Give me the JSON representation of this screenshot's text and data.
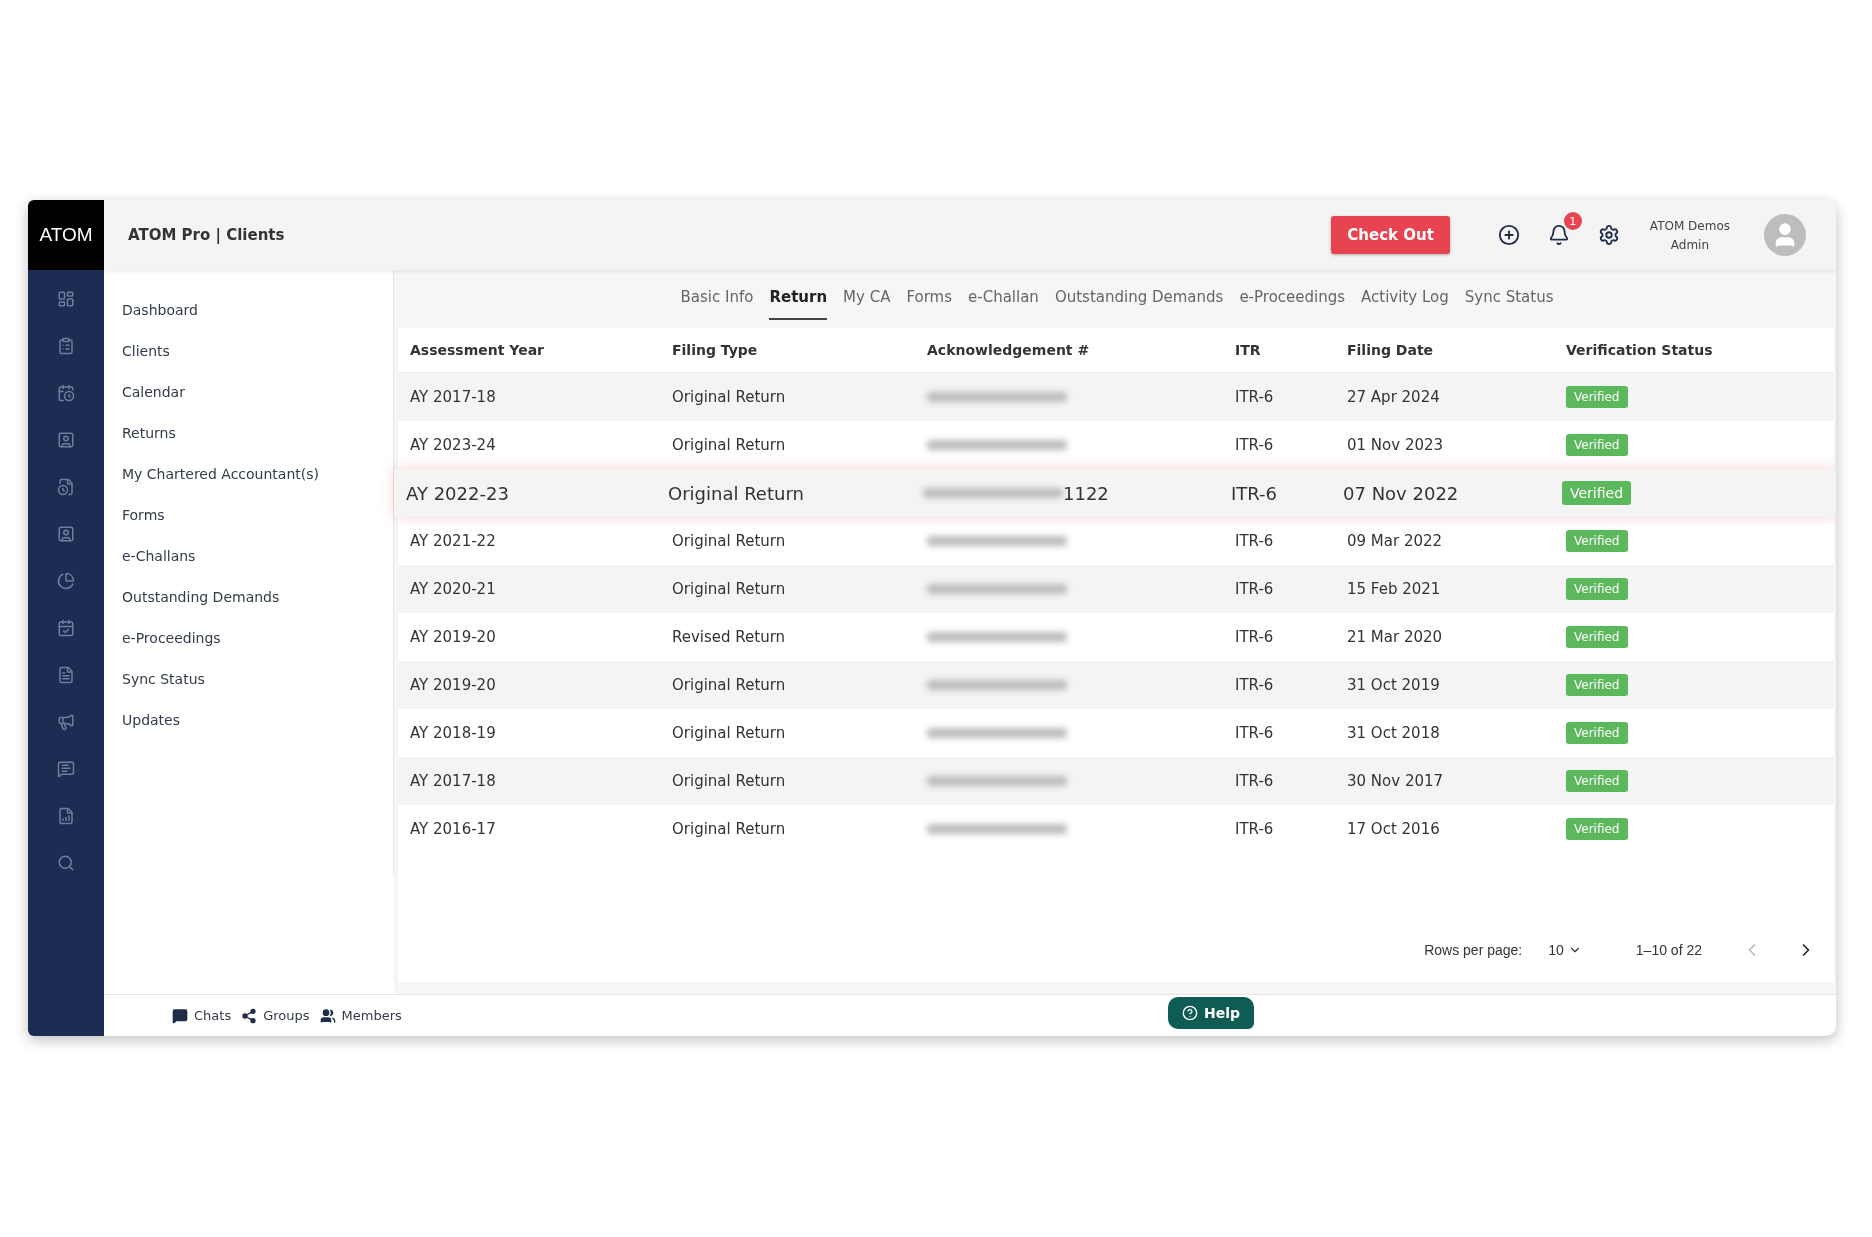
{
  "app": {
    "logo": "ATOM",
    "title": "ATOM Pro | Clients"
  },
  "header": {
    "checkout_label": "Check Out",
    "notification_count": "1",
    "user_name": "ATOM Demos",
    "user_role": "Admin"
  },
  "nav": [
    {
      "label": "Dashboard"
    },
    {
      "label": "Clients"
    },
    {
      "label": "Calendar"
    },
    {
      "label": "Returns"
    },
    {
      "label": "My Chartered Accountant(s)"
    },
    {
      "label": "Forms"
    },
    {
      "label": "e-Challans"
    },
    {
      "label": "Outstanding Demands"
    },
    {
      "label": "e-Proceedings"
    },
    {
      "label": "Sync Status"
    },
    {
      "label": "Updates"
    }
  ],
  "tabs": [
    {
      "label": "Basic Info",
      "selected": false
    },
    {
      "label": "Return",
      "selected": true
    },
    {
      "label": "My CA",
      "selected": false
    },
    {
      "label": "Forms",
      "selected": false
    },
    {
      "label": "e-Challan",
      "selected": false
    },
    {
      "label": "Outstanding Demands",
      "selected": false
    },
    {
      "label": "e-Proceedings",
      "selected": false
    },
    {
      "label": "Activity Log",
      "selected": false
    },
    {
      "label": "Sync Status",
      "selected": false
    }
  ],
  "table": {
    "columns": [
      "Assessment Year",
      "Filing Type",
      "Acknowledgement #",
      "ITR",
      "Filing Date",
      "Verification Status"
    ],
    "rows": [
      {
        "year": "AY 2017-18",
        "type": "Original Return",
        "redacted": true,
        "itr": "ITR-6",
        "date": "27 Apr 2024",
        "status": "Verified",
        "emphasized": false
      },
      {
        "year": "AY 2023-24",
        "type": "Original Return",
        "redacted": true,
        "itr": "ITR-6",
        "date": "01 Nov 2023",
        "status": "Verified",
        "emphasized": false
      },
      {
        "year": "AY 2022-23",
        "type": "Original Return",
        "redacted": true,
        "ack": "1122",
        "itr": "ITR-6",
        "date": "07 Nov 2022",
        "status": "Verified",
        "emphasized": true
      },
      {
        "year": "AY 2021-22",
        "type": "Original Return",
        "redacted": true,
        "itr": "ITR-6",
        "date": "09 Mar 2022",
        "status": "Verified",
        "emphasized": false
      },
      {
        "year": "AY 2020-21",
        "type": "Original Return",
        "redacted": true,
        "itr": "ITR-6",
        "date": "15 Feb 2021",
        "status": "Verified",
        "emphasized": false
      },
      {
        "year": "AY 2019-20",
        "type": "Revised Return",
        "redacted": true,
        "itr": "ITR-6",
        "date": "21 Mar 2020",
        "status": "Verified",
        "emphasized": false
      },
      {
        "year": "AY 2019-20",
        "type": "Original Return",
        "redacted": true,
        "itr": "ITR-6",
        "date": "31 Oct 2019",
        "status": "Verified",
        "emphasized": false
      },
      {
        "year": "AY 2018-19",
        "type": "Original Return",
        "redacted": true,
        "itr": "ITR-6",
        "date": "31 Oct 2018",
        "status": "Verified",
        "emphasized": false
      },
      {
        "year": "AY 2017-18",
        "type": "Original Return",
        "redacted": true,
        "itr": "ITR-6",
        "date": "30 Nov 2017",
        "status": "Verified",
        "emphasized": false
      },
      {
        "year": "AY 2016-17",
        "type": "Original Return",
        "redacted": true,
        "itr": "ITR-6",
        "date": "17 Oct 2016",
        "status": "Verified",
        "emphasized": false
      }
    ]
  },
  "pagination": {
    "rows_label": "Rows per page:",
    "rows_value": "10",
    "range": "1–10 of 22",
    "prev_disabled": true
  },
  "footer": {
    "links": [
      {
        "kind": "chats",
        "label": "Chats"
      },
      {
        "kind": "groups",
        "label": "Groups"
      },
      {
        "kind": "members",
        "label": "Members"
      }
    ],
    "help": "Help"
  }
}
